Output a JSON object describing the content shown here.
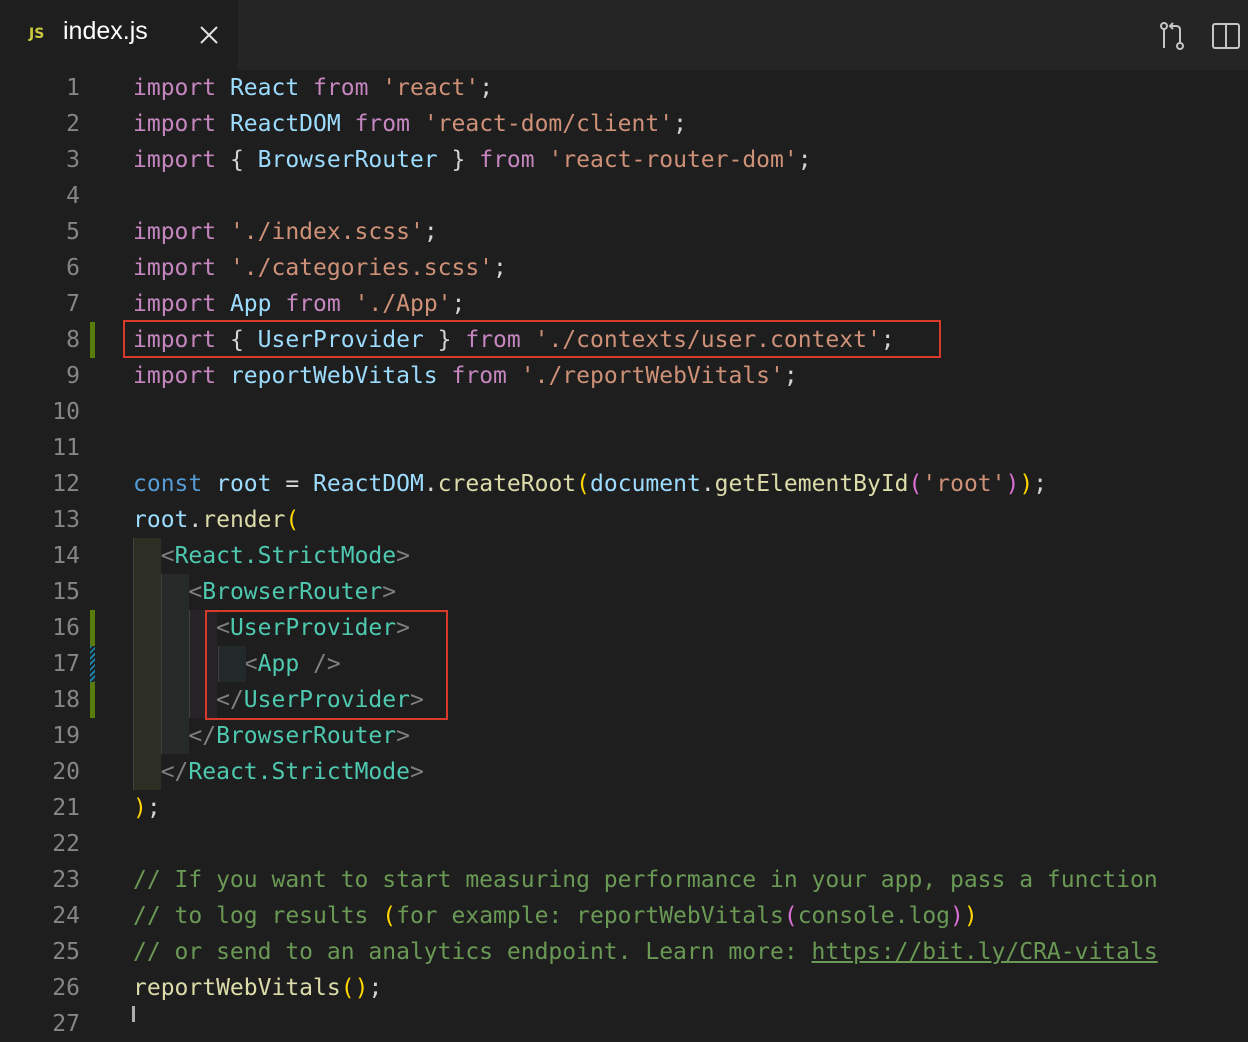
{
  "tab": {
    "language_badge": "JS",
    "title": "index.js"
  },
  "icons": {
    "tab_close": "close-icon",
    "open_changes": "open-changes-icon",
    "split_editor": "split-editor-icon"
  },
  "colors": {
    "background": "#1e1e1e",
    "line_number": "#858585",
    "keyword": "#c586c0",
    "string": "#ce9178",
    "type": "#4ec9b0",
    "comment": "#6a9955",
    "added_gutter": "#587c0c",
    "highlight_box": "#d7392b"
  },
  "lines": [
    {
      "n": "1",
      "t": [
        [
          "import ",
          "kw"
        ],
        [
          "React ",
          "var"
        ],
        [
          "from ",
          "kw"
        ],
        [
          "'react'",
          "str"
        ],
        [
          ";",
          ""
        ]
      ]
    },
    {
      "n": "2",
      "t": [
        [
          "import ",
          "kw"
        ],
        [
          "ReactDOM ",
          "var"
        ],
        [
          "from ",
          "kw"
        ],
        [
          "'react-dom/client'",
          "str"
        ],
        [
          ";",
          ""
        ]
      ]
    },
    {
      "n": "3",
      "t": [
        [
          "import ",
          "kw"
        ],
        [
          "{ ",
          ""
        ],
        [
          "BrowserRouter ",
          "var"
        ],
        [
          "} ",
          ""
        ],
        [
          "from ",
          "kw"
        ],
        [
          "'react-router-dom'",
          "str"
        ],
        [
          ";",
          ""
        ]
      ]
    },
    {
      "n": "4",
      "t": []
    },
    {
      "n": "5",
      "t": [
        [
          "import ",
          "kw"
        ],
        [
          "'./index.scss'",
          "str"
        ],
        [
          ";",
          ""
        ]
      ]
    },
    {
      "n": "6",
      "t": [
        [
          "import ",
          "kw"
        ],
        [
          "'./categories.scss'",
          "str"
        ],
        [
          ";",
          ""
        ]
      ]
    },
    {
      "n": "7",
      "t": [
        [
          "import ",
          "kw"
        ],
        [
          "App ",
          "var"
        ],
        [
          "from ",
          "kw"
        ],
        [
          "'./App'",
          "str"
        ],
        [
          ";",
          ""
        ]
      ]
    },
    {
      "n": "8",
      "t": [
        [
          "import ",
          "kw"
        ],
        [
          "{ ",
          ""
        ],
        [
          "UserProvider ",
          "var"
        ],
        [
          "} ",
          ""
        ],
        [
          "from ",
          "kw"
        ],
        [
          "'./contexts/user.context'",
          "str"
        ],
        [
          ";",
          ""
        ]
      ]
    },
    {
      "n": "9",
      "t": [
        [
          "import ",
          "kw"
        ],
        [
          "reportWebVitals ",
          "var"
        ],
        [
          "from ",
          "kw"
        ],
        [
          "'./reportWebVitals'",
          "str"
        ],
        [
          ";",
          ""
        ]
      ]
    },
    {
      "n": "10",
      "t": []
    },
    {
      "n": "11",
      "t": []
    },
    {
      "n": "12",
      "t": [
        [
          "const ",
          "kb"
        ],
        [
          "root ",
          "var"
        ],
        [
          "= ",
          ""
        ],
        [
          "ReactDOM",
          "var"
        ],
        [
          ".",
          ""
        ],
        [
          "createRoot",
          "fn"
        ],
        [
          "(",
          "br1"
        ],
        [
          "document",
          "var"
        ],
        [
          ".",
          ""
        ],
        [
          "getElementById",
          "fn"
        ],
        [
          "(",
          "br2"
        ],
        [
          "'root'",
          "str"
        ],
        [
          ")",
          "br2"
        ],
        [
          ")",
          "br1"
        ],
        [
          ";",
          ""
        ]
      ]
    },
    {
      "n": "13",
      "t": [
        [
          "root",
          "var"
        ],
        [
          ".",
          ""
        ],
        [
          "render",
          "fn"
        ],
        [
          "(",
          "br1"
        ]
      ]
    },
    {
      "n": "14",
      "t": [
        [
          "  ",
          ""
        ],
        [
          "<",
          "tagp"
        ],
        [
          "React.StrictMode",
          "typ"
        ],
        [
          ">",
          "tagp"
        ]
      ]
    },
    {
      "n": "15",
      "t": [
        [
          "    ",
          ""
        ],
        [
          "<",
          "tagp"
        ],
        [
          "BrowserRouter",
          "typ"
        ],
        [
          ">",
          "tagp"
        ]
      ]
    },
    {
      "n": "16",
      "t": [
        [
          "      ",
          ""
        ],
        [
          "<",
          "tagp"
        ],
        [
          "UserProvider",
          "typ"
        ],
        [
          ">",
          "tagp"
        ]
      ]
    },
    {
      "n": "17",
      "t": [
        [
          "        ",
          ""
        ],
        [
          "<",
          "tagp"
        ],
        [
          "App ",
          "typ"
        ],
        [
          "/>",
          "tagp"
        ]
      ]
    },
    {
      "n": "18",
      "t": [
        [
          "      ",
          ""
        ],
        [
          "</",
          "tagp"
        ],
        [
          "UserProvider",
          "typ"
        ],
        [
          ">",
          "tagp"
        ]
      ]
    },
    {
      "n": "19",
      "t": [
        [
          "    ",
          ""
        ],
        [
          "</",
          "tagp"
        ],
        [
          "BrowserRouter",
          "typ"
        ],
        [
          ">",
          "tagp"
        ]
      ]
    },
    {
      "n": "20",
      "t": [
        [
          "  ",
          ""
        ],
        [
          "</",
          "tagp"
        ],
        [
          "React.StrictMode",
          "typ"
        ],
        [
          ">",
          "tagp"
        ]
      ]
    },
    {
      "n": "21",
      "t": [
        [
          ")",
          "br1"
        ],
        [
          ";",
          ""
        ]
      ]
    },
    {
      "n": "22",
      "t": []
    },
    {
      "n": "23",
      "t": [
        [
          "// If you want to start measuring performance in your app, pass a function",
          "com"
        ]
      ]
    },
    {
      "n": "24",
      "t": [
        [
          "// to log results ",
          "com"
        ],
        [
          "(",
          "br1"
        ],
        [
          "for example: reportWebVitals",
          "com"
        ],
        [
          "(",
          "br2"
        ],
        [
          "console.log",
          "com"
        ],
        [
          ")",
          "br2"
        ],
        [
          ")",
          "br1"
        ]
      ]
    },
    {
      "n": "25",
      "t": [
        [
          "// or send to an analytics endpoint. Learn more: ",
          "com"
        ],
        [
          "https://bit.ly/CRA-vitals",
          "com link"
        ]
      ]
    },
    {
      "n": "26",
      "t": [
        [
          "reportWebVitals",
          "fn"
        ],
        [
          "(",
          "br1"
        ],
        [
          ")",
          "br1"
        ],
        [
          ";",
          ""
        ]
      ]
    },
    {
      "n": "27",
      "t": []
    }
  ]
}
